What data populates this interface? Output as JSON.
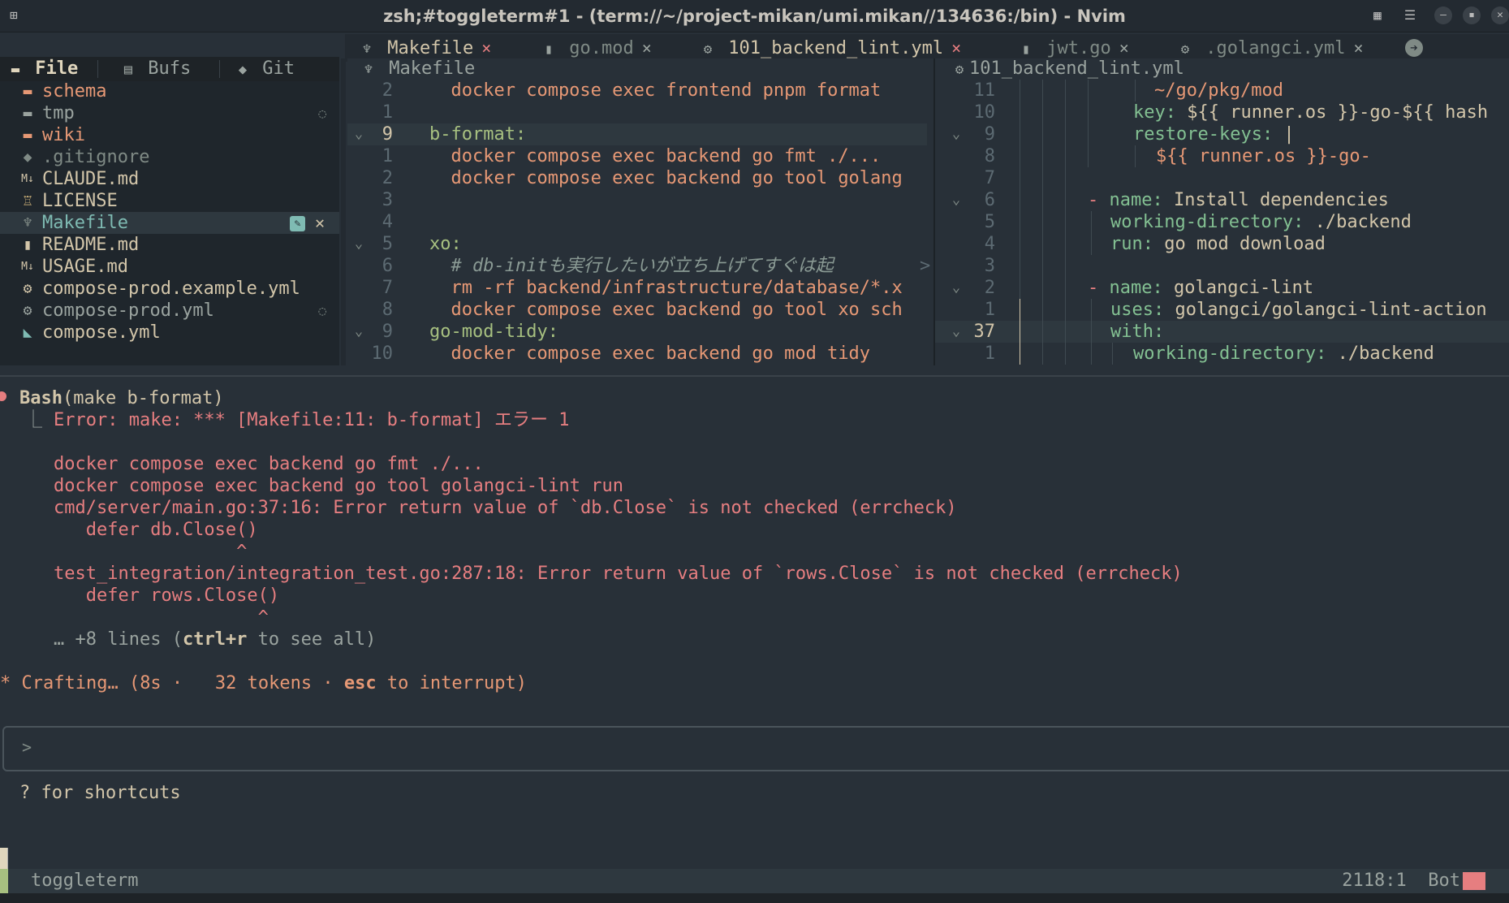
{
  "window": {
    "title": "zsh;#toggleterm#1 - (term://~/project-mikan/umi.mikan//134636:/bin) - Nvim"
  },
  "tabs": [
    {
      "label": "Makefile",
      "active": true,
      "close": "×"
    },
    {
      "label": "go.mod",
      "active": false,
      "close": "×"
    },
    {
      "label": "101_backend_lint.yml",
      "active": true,
      "close": "×"
    },
    {
      "label": "jwt.go",
      "active": false,
      "close": "×"
    },
    {
      "label": ".golangci.yml",
      "active": false,
      "close": "×"
    }
  ],
  "sidebar": {
    "tabs": [
      {
        "label": "File"
      },
      {
        "label": "Bufs"
      },
      {
        "label": "Git"
      }
    ],
    "files": [
      {
        "name": "schema",
        "icon": "folder-icon",
        "color": "#e69875"
      },
      {
        "name": "tmp",
        "icon": "folder-icon",
        "color": "#9aa39f"
      },
      {
        "name": "wiki",
        "icon": "folder-icon",
        "color": "#e69875"
      },
      {
        "name": ".gitignore",
        "icon": "git-icon",
        "color": "#7f8a85"
      },
      {
        "name": "CLAUDE.md",
        "icon": "markdown-icon",
        "color": "#d3c6aa"
      },
      {
        "name": "LICENSE",
        "icon": "license-icon",
        "color": "#d3c6aa"
      },
      {
        "name": "Makefile",
        "icon": "makefile-icon",
        "color": "#7fbbb3"
      },
      {
        "name": "README.md",
        "icon": "readme-icon",
        "color": "#d3c6aa"
      },
      {
        "name": "USAGE.md",
        "icon": "markdown-icon",
        "color": "#d3c6aa"
      },
      {
        "name": "compose-prod.example.yml",
        "icon": "gear-icon",
        "color": "#d3c6aa"
      },
      {
        "name": "compose-prod.yml",
        "icon": "gear-icon",
        "color": "#9aa39f"
      },
      {
        "name": "compose.yml",
        "icon": "docker-icon",
        "color": "#d3c6aa"
      }
    ]
  },
  "left_pane": {
    "winbar": "Makefile",
    "lines": [
      {
        "num": "2",
        "code": "  docker compose exec frontend pnpm format"
      },
      {
        "num": "1",
        "code": ""
      },
      {
        "num": "9",
        "code": "b-format:"
      },
      {
        "num": "1",
        "code": "  docker compose exec backend go fmt ./..."
      },
      {
        "num": "2",
        "code": "  docker compose exec backend go tool golang"
      },
      {
        "num": "3",
        "code": ""
      },
      {
        "num": "4",
        "code": ""
      },
      {
        "num": "5",
        "code": "xo:"
      },
      {
        "num": "6",
        "code": "  # db-initも実行したいが立ち上げてすぐは起"
      },
      {
        "num": "7",
        "code": "  rm -rf backend/infrastructure/database/*.x"
      },
      {
        "num": "8",
        "code": "  docker compose exec backend go tool xo sch"
      },
      {
        "num": "9",
        "code": "go-mod-tidy:"
      },
      {
        "num": "10",
        "code": "  docker compose exec backend go mod tidy"
      }
    ],
    "truncation_mark": ">"
  },
  "right_pane": {
    "winbar": "101_backend_lint.yml",
    "lines": [
      {
        "num": "11",
        "key": "",
        "value": "~/go/pkg/mod"
      },
      {
        "num": "10",
        "key": "key:",
        "value": " ${{ runner.os }}-go-${{ hash"
      },
      {
        "num": "9",
        "key": "restore-keys:",
        "value": " |"
      },
      {
        "num": "8",
        "key": "",
        "value": "${{ runner.os }}-go-"
      },
      {
        "num": "7",
        "key": "",
        "value": ""
      },
      {
        "num": "6",
        "key": "name:",
        "value": " Install dependencies"
      },
      {
        "num": "5",
        "key": "working-directory:",
        "value": " ./backend"
      },
      {
        "num": "4",
        "key": "run:",
        "value": " go mod download"
      },
      {
        "num": "3",
        "key": "",
        "value": ""
      },
      {
        "num": "2",
        "key": "name:",
        "value": " golangci-lint"
      },
      {
        "num": "1",
        "key": "uses:",
        "value": " golangci/golangci-lint-action"
      },
      {
        "num": "37",
        "key": "with:",
        "value": ""
      },
      {
        "num": "1",
        "key": "working-directory:",
        "value": " ./backend"
      }
    ]
  },
  "terminal": {
    "tool_name": "Bash",
    "tool_args": "(make b-format)",
    "error_line": "Error: make: *** [Makefile:11: b-format] エラー 1",
    "output": [
      "docker compose exec backend go fmt ./...",
      "docker compose exec backend go tool golangci-lint run",
      "cmd/server/main.go:37:16: Error return value of `db.Close` is not checked (errcheck)",
      "   defer db.Close()",
      "                 ^",
      "test_integration/integration_test.go:287:18: Error return value of `rows.Close` is not checked (errcheck)",
      "   defer rows.Close()",
      "                   ^"
    ],
    "more_prefix": "… +8 lines (",
    "more_key": "ctrl+r",
    "more_suffix": " to see all)",
    "status_star": "*",
    "status_text": " Crafting… (8s ·   32 tokens · ",
    "status_key": "esc",
    "status_suffix": " to interrupt)",
    "prompt": ">",
    "shortcuts_hint": "? for shortcuts"
  },
  "statusline": {
    "mode": "toggleterm",
    "position": "2118:1",
    "scroll": "Bot"
  },
  "colors": {
    "background": "#283038",
    "error": "#e67e80",
    "accent_green": "#a7c080",
    "keyword": "#83c092",
    "string": "#e69875"
  }
}
